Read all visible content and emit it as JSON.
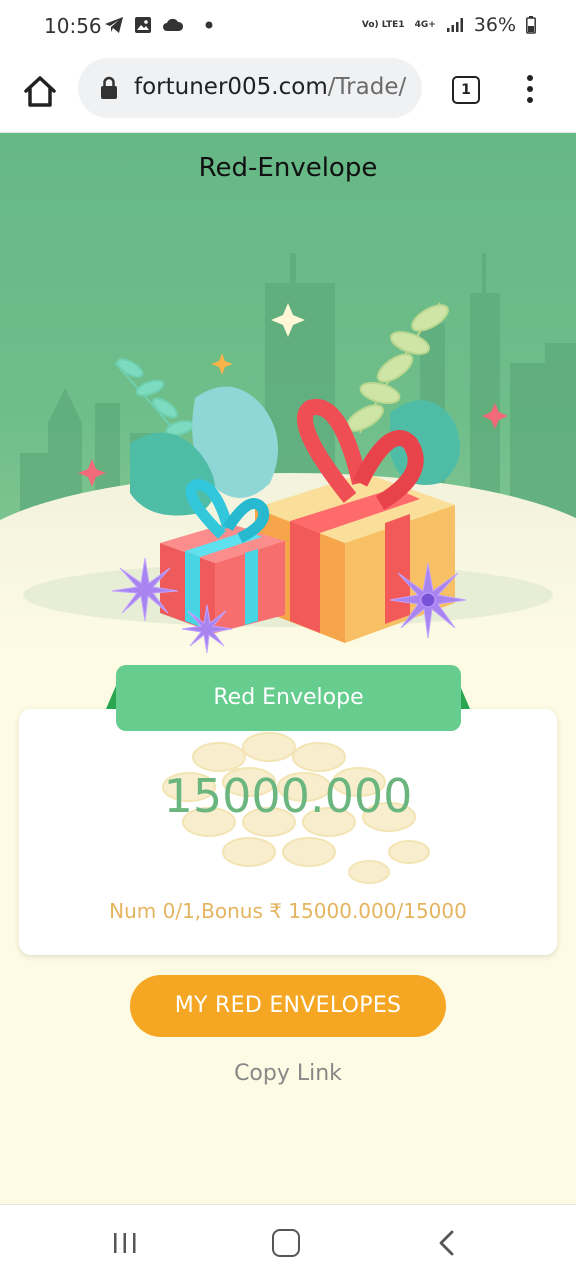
{
  "status_bar": {
    "time": "10:56",
    "network": "Vo) LTE1",
    "network_type": "4G+",
    "battery": "36%"
  },
  "browser": {
    "url_domain": "fortuner005.com",
    "url_path": "/Trade/",
    "tab_count": "1"
  },
  "page": {
    "title": "Red-Envelope",
    "ribbon_label": "Red Envelope",
    "amount": "15000.000",
    "detail": "Num 0/1,Bonus ₹ 15000.000/15000",
    "my_button": "MY RED ENVELOPES",
    "copy_link": "Copy Link"
  },
  "colors": {
    "hero_green": "#66b886",
    "ribbon_green": "#66cd8f",
    "amount_green": "#6bb67e",
    "button_orange": "#f5a623",
    "detail_gold": "#e5b45f",
    "page_bg": "#fdfbe3"
  }
}
